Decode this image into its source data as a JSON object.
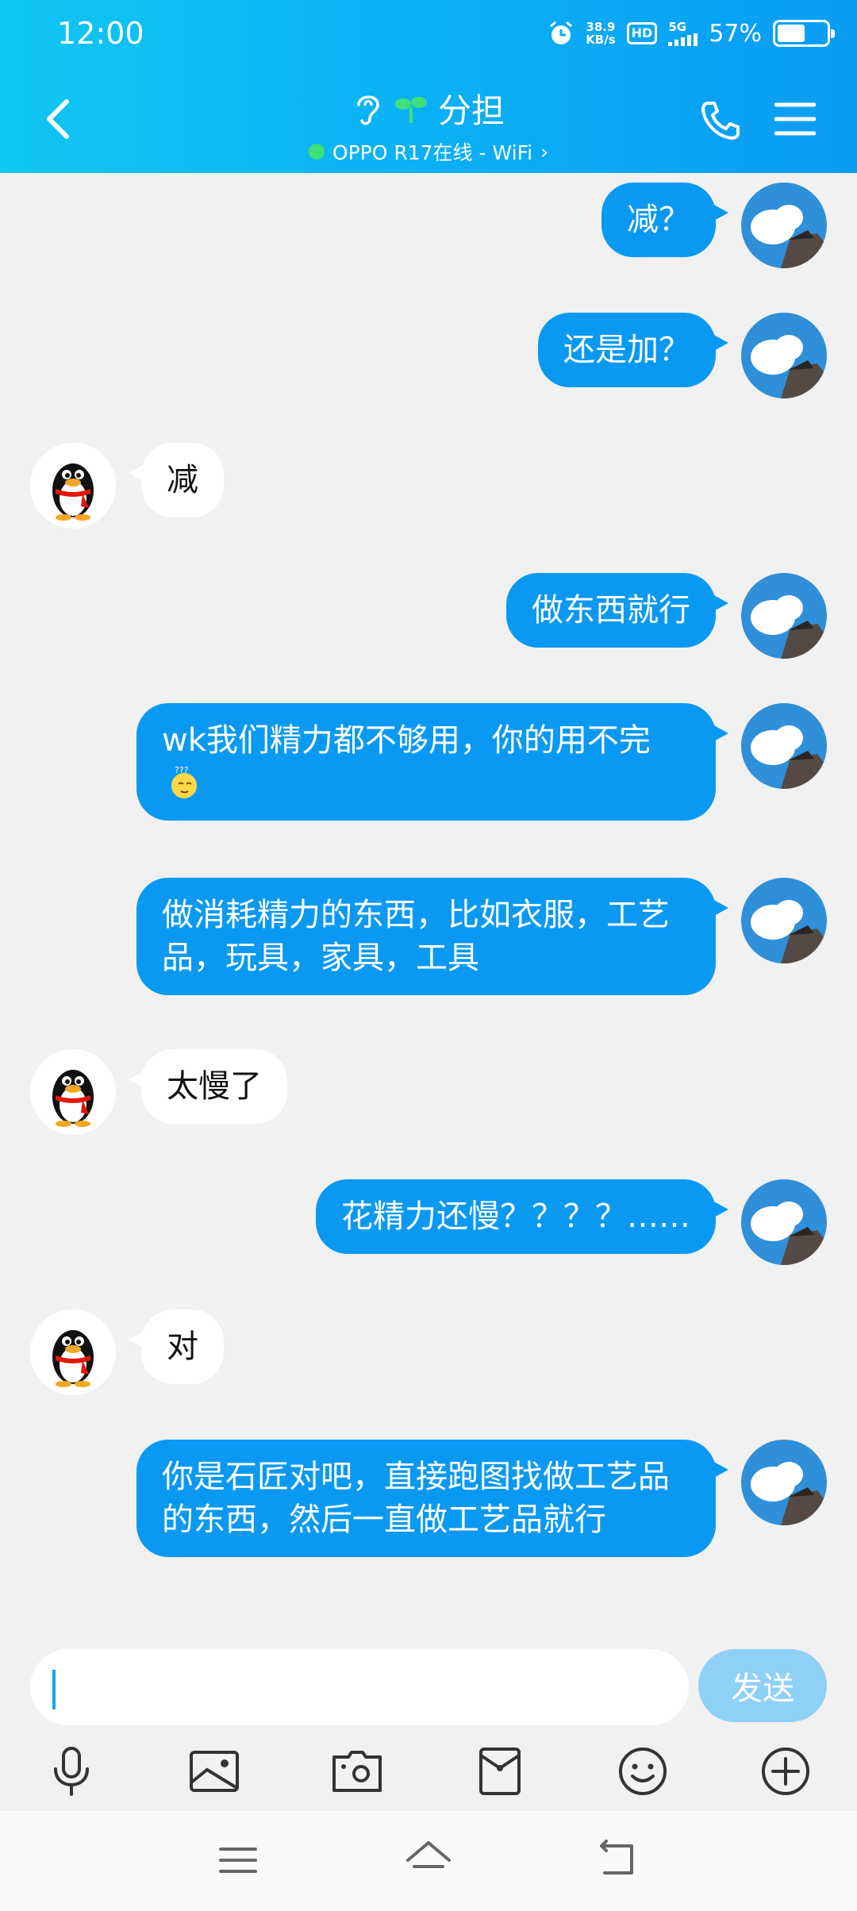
{
  "status_bar": {
    "time": "12:00",
    "net_speed_value": "38.9",
    "net_speed_unit": "KB/s",
    "hd": "HD",
    "network": "5G",
    "battery": "57%",
    "battery_level": 0.57
  },
  "header": {
    "title": "分担",
    "subtitle": "OPPO R17在线 - WiFi",
    "subtitle_chevron": "›",
    "icons": [
      "ear-icon",
      "sprout-icon",
      "back-icon",
      "phone-icon",
      "menu-icon"
    ]
  },
  "messages": [
    {
      "sender": "me",
      "text": "减？"
    },
    {
      "sender": "me",
      "text": "还是加？"
    },
    {
      "sender": "other",
      "text": "减"
    },
    {
      "sender": "me",
      "text": "做东西就行"
    },
    {
      "sender": "me",
      "text": "wk我们精力都不够用，你的用不完",
      "emoji": "thinking-emoji"
    },
    {
      "sender": "me",
      "text": "做消耗精力的东西，比如衣服，工艺品，玩具，家具，工具"
    },
    {
      "sender": "other",
      "text": "太慢了"
    },
    {
      "sender": "me",
      "text": "花精力还慢？？？？……"
    },
    {
      "sender": "other",
      "text": "对"
    },
    {
      "sender": "me",
      "text": "你是石匠对吧，直接跑图找做工艺品的东西，然后一直做工艺品就行"
    }
  ],
  "input_bar": {
    "value": "",
    "send_label": "发送",
    "tools": [
      "microphone-icon",
      "image-icon",
      "camera-icon",
      "red-packet-icon",
      "emoji-icon",
      "plus-icon"
    ]
  },
  "nav_bar": {
    "icons": [
      "menu-nav-icon",
      "home-nav-icon",
      "back-nav-icon"
    ]
  },
  "colors": {
    "header_start": "#10c7f3",
    "header_end": "#0a9cf4",
    "my_bubble": "#0a99f2",
    "send_button": "#8fd0f7",
    "online": "#3ee07a"
  }
}
